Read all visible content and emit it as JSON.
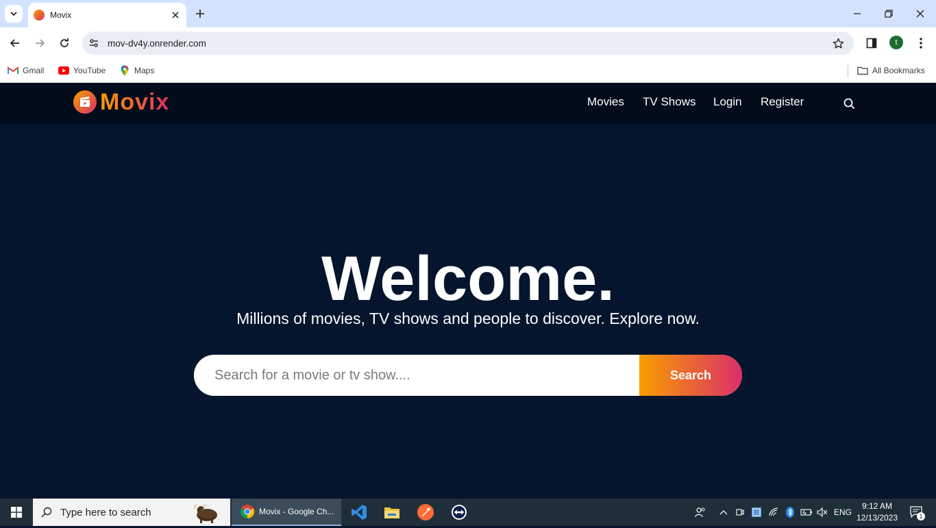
{
  "browser": {
    "tab_title": "Movix",
    "url": "mov-dv4y.onrender.com",
    "profile_initial": "t",
    "bookmarks": [
      {
        "label": "Gmail",
        "icon": "gmail-icon"
      },
      {
        "label": "YouTube",
        "icon": "youtube-icon"
      },
      {
        "label": "Maps",
        "icon": "maps-icon"
      }
    ],
    "all_bookmarks_label": "All Bookmarks"
  },
  "site": {
    "logo_text": "Movix",
    "nav": {
      "movies": "Movies",
      "tv_shows": "TV Shows",
      "login": "Login",
      "register": "Register"
    },
    "hero": {
      "title": "Welcome.",
      "subtitle": "Millions of movies, TV shows and people to discover. Explore now.",
      "search_placeholder": "Search for a movie or tv show....",
      "search_button": "Search"
    },
    "colors": {
      "background": "#04152d",
      "header": "#020c1b",
      "gradient_start": "#f89e00",
      "gradient_end": "#da2f68"
    }
  },
  "taskbar": {
    "search_placeholder": "Type here to search",
    "chrome_label": "Movix - Google Ch...",
    "language": "ENG",
    "time": "9:12 AM",
    "date": "12/13/2023",
    "notification_count": "1"
  }
}
